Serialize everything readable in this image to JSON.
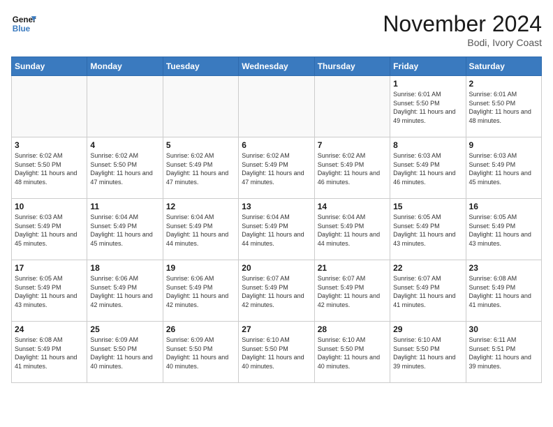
{
  "header": {
    "logo_line1": "General",
    "logo_line2": "Blue",
    "month_title": "November 2024",
    "location": "Bodi, Ivory Coast"
  },
  "calendar": {
    "days_of_week": [
      "Sunday",
      "Monday",
      "Tuesday",
      "Wednesday",
      "Thursday",
      "Friday",
      "Saturday"
    ],
    "weeks": [
      [
        {
          "day": "",
          "info": ""
        },
        {
          "day": "",
          "info": ""
        },
        {
          "day": "",
          "info": ""
        },
        {
          "day": "",
          "info": ""
        },
        {
          "day": "",
          "info": ""
        },
        {
          "day": "1",
          "info": "Sunrise: 6:01 AM\nSunset: 5:50 PM\nDaylight: 11 hours and 49 minutes."
        },
        {
          "day": "2",
          "info": "Sunrise: 6:01 AM\nSunset: 5:50 PM\nDaylight: 11 hours and 48 minutes."
        }
      ],
      [
        {
          "day": "3",
          "info": "Sunrise: 6:02 AM\nSunset: 5:50 PM\nDaylight: 11 hours and 48 minutes."
        },
        {
          "day": "4",
          "info": "Sunrise: 6:02 AM\nSunset: 5:50 PM\nDaylight: 11 hours and 47 minutes."
        },
        {
          "day": "5",
          "info": "Sunrise: 6:02 AM\nSunset: 5:49 PM\nDaylight: 11 hours and 47 minutes."
        },
        {
          "day": "6",
          "info": "Sunrise: 6:02 AM\nSunset: 5:49 PM\nDaylight: 11 hours and 47 minutes."
        },
        {
          "day": "7",
          "info": "Sunrise: 6:02 AM\nSunset: 5:49 PM\nDaylight: 11 hours and 46 minutes."
        },
        {
          "day": "8",
          "info": "Sunrise: 6:03 AM\nSunset: 5:49 PM\nDaylight: 11 hours and 46 minutes."
        },
        {
          "day": "9",
          "info": "Sunrise: 6:03 AM\nSunset: 5:49 PM\nDaylight: 11 hours and 45 minutes."
        }
      ],
      [
        {
          "day": "10",
          "info": "Sunrise: 6:03 AM\nSunset: 5:49 PM\nDaylight: 11 hours and 45 minutes."
        },
        {
          "day": "11",
          "info": "Sunrise: 6:04 AM\nSunset: 5:49 PM\nDaylight: 11 hours and 45 minutes."
        },
        {
          "day": "12",
          "info": "Sunrise: 6:04 AM\nSunset: 5:49 PM\nDaylight: 11 hours and 44 minutes."
        },
        {
          "day": "13",
          "info": "Sunrise: 6:04 AM\nSunset: 5:49 PM\nDaylight: 11 hours and 44 minutes."
        },
        {
          "day": "14",
          "info": "Sunrise: 6:04 AM\nSunset: 5:49 PM\nDaylight: 11 hours and 44 minutes."
        },
        {
          "day": "15",
          "info": "Sunrise: 6:05 AM\nSunset: 5:49 PM\nDaylight: 11 hours and 43 minutes."
        },
        {
          "day": "16",
          "info": "Sunrise: 6:05 AM\nSunset: 5:49 PM\nDaylight: 11 hours and 43 minutes."
        }
      ],
      [
        {
          "day": "17",
          "info": "Sunrise: 6:05 AM\nSunset: 5:49 PM\nDaylight: 11 hours and 43 minutes."
        },
        {
          "day": "18",
          "info": "Sunrise: 6:06 AM\nSunset: 5:49 PM\nDaylight: 11 hours and 42 minutes."
        },
        {
          "day": "19",
          "info": "Sunrise: 6:06 AM\nSunset: 5:49 PM\nDaylight: 11 hours and 42 minutes."
        },
        {
          "day": "20",
          "info": "Sunrise: 6:07 AM\nSunset: 5:49 PM\nDaylight: 11 hours and 42 minutes."
        },
        {
          "day": "21",
          "info": "Sunrise: 6:07 AM\nSunset: 5:49 PM\nDaylight: 11 hours and 42 minutes."
        },
        {
          "day": "22",
          "info": "Sunrise: 6:07 AM\nSunset: 5:49 PM\nDaylight: 11 hours and 41 minutes."
        },
        {
          "day": "23",
          "info": "Sunrise: 6:08 AM\nSunset: 5:49 PM\nDaylight: 11 hours and 41 minutes."
        }
      ],
      [
        {
          "day": "24",
          "info": "Sunrise: 6:08 AM\nSunset: 5:49 PM\nDaylight: 11 hours and 41 minutes."
        },
        {
          "day": "25",
          "info": "Sunrise: 6:09 AM\nSunset: 5:50 PM\nDaylight: 11 hours and 40 minutes."
        },
        {
          "day": "26",
          "info": "Sunrise: 6:09 AM\nSunset: 5:50 PM\nDaylight: 11 hours and 40 minutes."
        },
        {
          "day": "27",
          "info": "Sunrise: 6:10 AM\nSunset: 5:50 PM\nDaylight: 11 hours and 40 minutes."
        },
        {
          "day": "28",
          "info": "Sunrise: 6:10 AM\nSunset: 5:50 PM\nDaylight: 11 hours and 40 minutes."
        },
        {
          "day": "29",
          "info": "Sunrise: 6:10 AM\nSunset: 5:50 PM\nDaylight: 11 hours and 39 minutes."
        },
        {
          "day": "30",
          "info": "Sunrise: 6:11 AM\nSunset: 5:51 PM\nDaylight: 11 hours and 39 minutes."
        }
      ]
    ]
  }
}
